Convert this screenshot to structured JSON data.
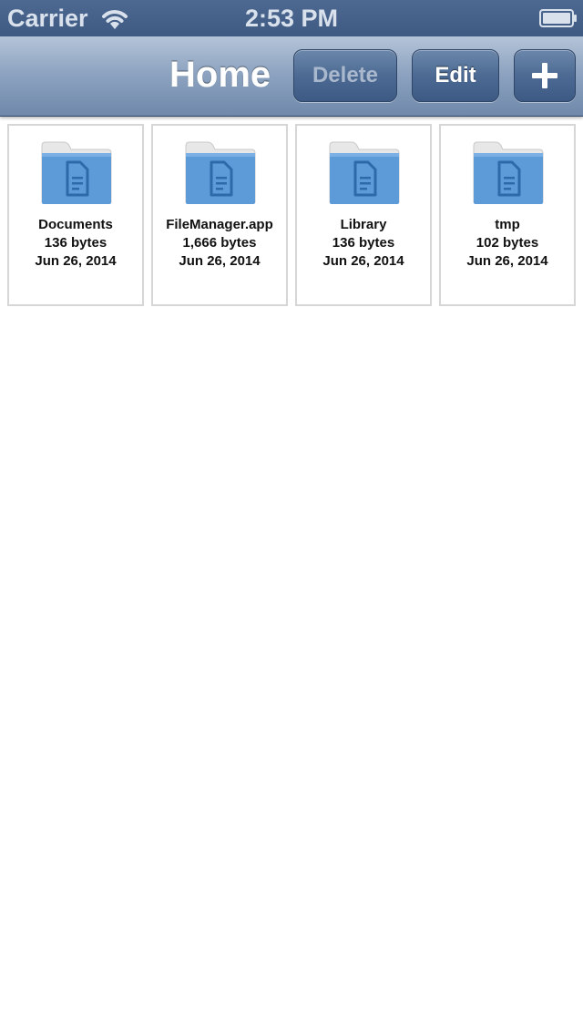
{
  "status_bar": {
    "carrier": "Carrier",
    "time": "2:53 PM"
  },
  "nav": {
    "title": "Home",
    "delete_label": "Delete",
    "edit_label": "Edit",
    "add_icon": "plus-icon"
  },
  "files": [
    {
      "name": "Documents",
      "size": "136 bytes",
      "date": "Jun 26, 2014",
      "icon": "folder-icon"
    },
    {
      "name": "FileManager.app",
      "size": "1,666 bytes",
      "date": "Jun 26, 2014",
      "icon": "folder-icon"
    },
    {
      "name": "Library",
      "size": "136 bytes",
      "date": "Jun 26, 2014",
      "icon": "folder-icon"
    },
    {
      "name": "tmp",
      "size": "102 bytes",
      "date": "Jun 26, 2014",
      "icon": "folder-icon"
    }
  ],
  "colors": {
    "nav_bar": "#8ea4c1",
    "status_bar": "#4d6991",
    "folder_blue": "#5c9ad8",
    "folder_back": "#e9e9e9"
  }
}
